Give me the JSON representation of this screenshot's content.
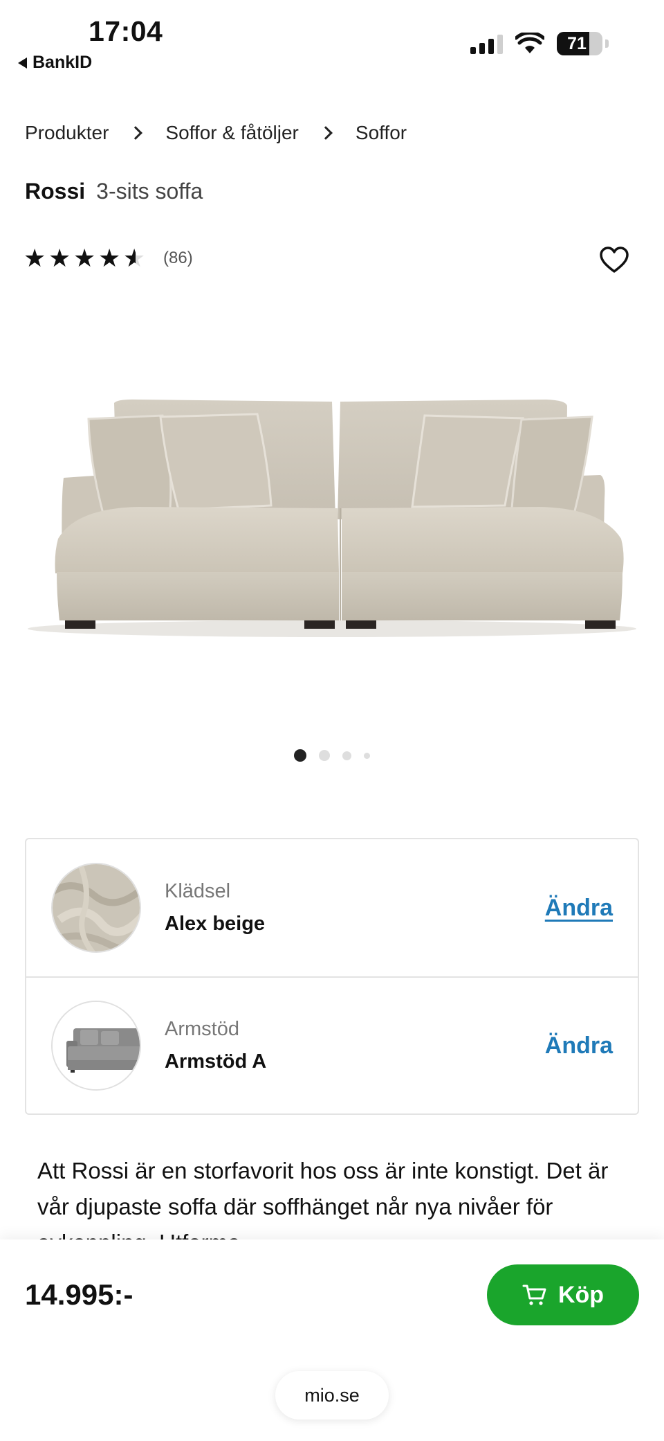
{
  "status_bar": {
    "time": "17:04",
    "back_app": "BankID",
    "battery_percent": "71",
    "battery_level": 0.71,
    "signal_bars": 3
  },
  "breadcrumb": {
    "items": [
      "Produkter",
      "Soffor & fåtöljer",
      "Soffor"
    ]
  },
  "product": {
    "name": "Rossi",
    "subtitle": "3-sits soffa",
    "rating": 4.5,
    "rating_max": 5,
    "review_count": "(86)"
  },
  "gallery": {
    "slide_count": 4,
    "active_index": 0
  },
  "options": [
    {
      "label": "Klädsel",
      "value": "Alex beige",
      "action": "Ändra"
    },
    {
      "label": "Armstöd",
      "value": "Armstöd A",
      "action": "Ändra"
    }
  ],
  "description": "Att Rossi är en storfavorit hos oss är inte konstigt. Det är vår djupaste soffa där soffhänget når nya nivåer för avkoppling. Utforma.",
  "buy": {
    "price": "14.995:-",
    "button_label": "Köp",
    "button_color": "#1aa52c"
  },
  "browser": {
    "url": "mio.se"
  },
  "colors": {
    "link": "#1f7ab8",
    "sofa_fabric": "#d6d0c4"
  }
}
